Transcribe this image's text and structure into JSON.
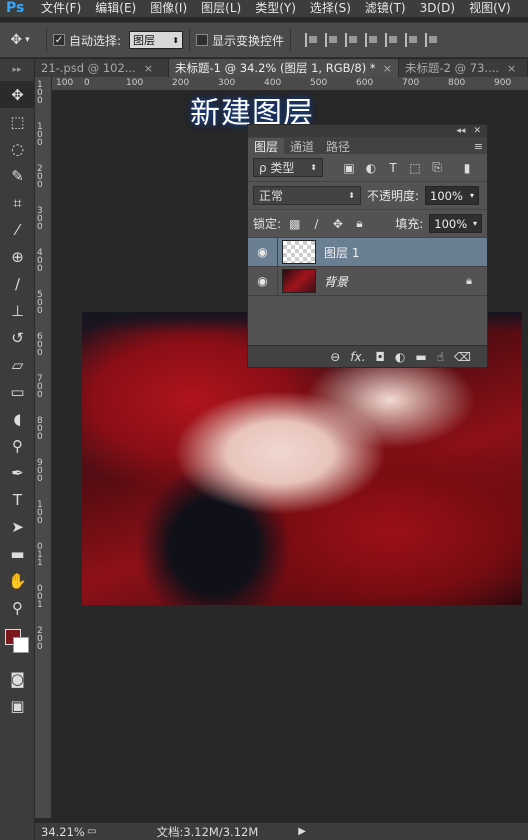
{
  "app": {
    "logo": "Ps"
  },
  "menu": [
    "文件(F)",
    "编辑(E)",
    "图像(I)",
    "图层(L)",
    "类型(Y)",
    "选择(S)",
    "滤镜(T)",
    "3D(D)",
    "视图(V)"
  ],
  "options": {
    "tool_icon": "move-icon",
    "auto_select_label": "自动选择:",
    "auto_select_checked": "✓",
    "auto_select_value": "图层",
    "show_transform_label": "显示变换控件"
  },
  "tabs": [
    {
      "label": "21-.psd @ 102...",
      "close": "×"
    },
    {
      "label": "未标题-1 @ 34.2% (图层 1, RGB/8) *",
      "close": "×"
    },
    {
      "label": "未标题-2 @ 73....",
      "close": "×"
    }
  ],
  "ruler": {
    "h": [
      "100",
      "0",
      "100",
      "200",
      "300",
      "400",
      "500",
      "600",
      "700",
      "800",
      "900"
    ],
    "v": [
      "1",
      "0",
      "0",
      "1",
      "0",
      "0",
      "2",
      "0",
      "0",
      "3",
      "0",
      "0",
      "4",
      "0",
      "0",
      "5",
      "0",
      "0",
      "6",
      "0",
      "0",
      "7",
      "0",
      "0",
      "8",
      "0",
      "0",
      "9",
      "0",
      "0",
      "1",
      "0",
      "0",
      "0",
      "1",
      "1",
      "0",
      "0",
      "1",
      "2",
      "0",
      "0"
    ]
  },
  "overlay_title": "新建图层",
  "layers_panel": {
    "tabs": [
      "图层",
      "通道",
      "路径"
    ],
    "filter_label": "ρ 类型",
    "blend_mode": "正常",
    "opacity_label": "不透明度:",
    "opacity_value": "100%",
    "lock_label": "锁定:",
    "fill_label": "填充:",
    "fill_value": "100%",
    "layers": [
      {
        "name": "图层 1",
        "selected": true
      },
      {
        "name": "背景",
        "locked": true
      }
    ],
    "footer_icons": [
      "link-icon",
      "fx-icon",
      "mask-icon",
      "adjustment-icon",
      "folder-icon",
      "new-layer-icon",
      "trash-icon"
    ],
    "footer_fx": "fx."
  },
  "status": {
    "zoom": "34.21%",
    "doc": "文档:3.12M/3.12M",
    "arrow": "▶"
  },
  "colors": {
    "accent": "#30a8ff",
    "selected_layer": "#6b7f93",
    "foreground_color": "#7a1a20"
  }
}
